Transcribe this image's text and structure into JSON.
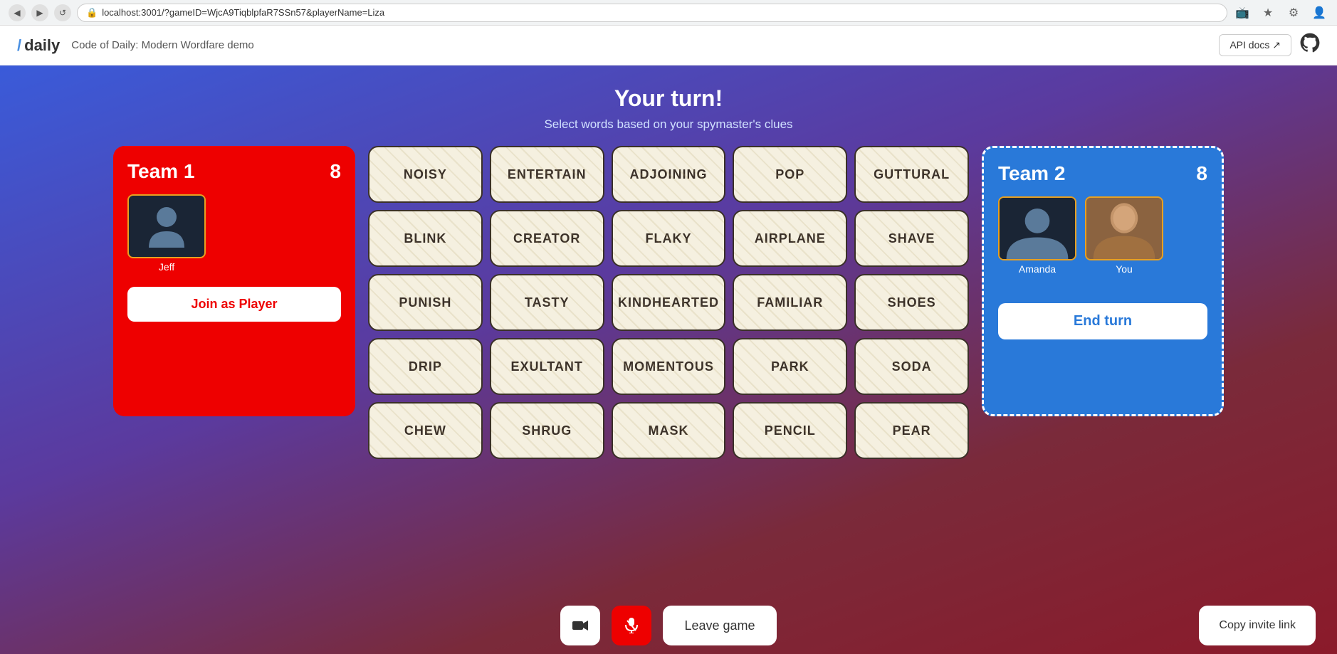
{
  "browser": {
    "back_icon": "◀",
    "forward_icon": "▶",
    "reload_icon": "↺",
    "url": "localhost:3001/?gameID=WjcA9TiqblpfaR7SSn57&playerName=Liza",
    "lock_icon": "🔒"
  },
  "header": {
    "logo_slash": "/",
    "logo_text": "daily",
    "app_title": "Code of Daily: Modern Wordfare demo",
    "api_docs_label": "API docs ↗",
    "github_icon": "⊙"
  },
  "turn": {
    "title": "Your turn!",
    "subtitle": "Select words based on your spymaster's clues"
  },
  "team1": {
    "name": "Team 1",
    "score": "8",
    "player_name": "Jeff",
    "join_btn": "Join as Player"
  },
  "team2": {
    "name": "Team 2",
    "score": "8",
    "player1_name": "Amanda",
    "player2_name": "You",
    "end_turn_btn": "End turn"
  },
  "words": [
    "NOISY",
    "ENTERTAIN",
    "ADJOINING",
    "POP",
    "GUTTURAL",
    "BLINK",
    "CREATOR",
    "FLAKY",
    "AIRPLANE",
    "SHAVE",
    "PUNISH",
    "TASTY",
    "KINDHEARTED",
    "FAMILIAR",
    "SHOES",
    "DRIP",
    "EXULTANT",
    "MOMENTOUS",
    "PARK",
    "SODA",
    "CHEW",
    "SHRUG",
    "MASK",
    "PENCIL",
    "PEAR"
  ],
  "bottom": {
    "camera_icon": "📷",
    "mic_icon": "🎤",
    "leave_game": "Leave game",
    "copy_invite": "Copy invite link"
  }
}
